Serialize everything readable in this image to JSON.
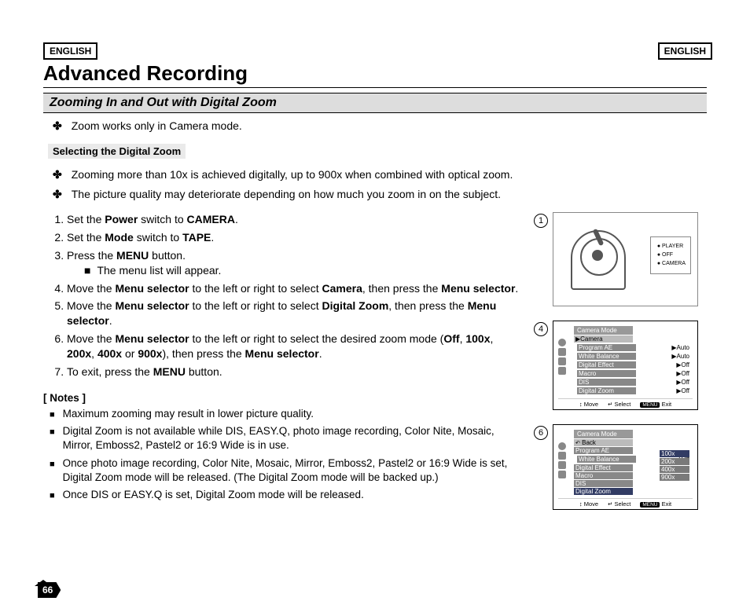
{
  "lang_label": "ENGLISH",
  "title": "Advanced Recording",
  "subtitle": "Zooming In and Out with Digital Zoom",
  "intro_bullet": "Zoom works only in Camera mode.",
  "subhead": "Selecting the Digital Zoom",
  "sub_bullets": [
    "Zooming more than 10x is achieved digitally, up to 900x when combined with optical zoom.",
    "The picture quality may deteriorate depending on how much you zoom in on the subject."
  ],
  "steps": [
    {
      "pre": "Set the ",
      "b1": "Power",
      "mid": " switch to ",
      "b2": "CAMERA",
      "post": "."
    },
    {
      "pre": "Set the ",
      "b1": "Mode",
      "mid": " switch to ",
      "b2": "TAPE",
      "post": "."
    },
    {
      "pre": "Press the ",
      "b1": "MENU",
      "mid": " button.",
      "b2": "",
      "post": ""
    },
    {
      "sub": "The menu list will appear."
    },
    {
      "pre": "Move the ",
      "b1": "Menu selector",
      "mid": " to the left or right to select ",
      "b2": "Camera",
      "post": ", then press the ",
      "b3": "Menu selector",
      "post2": "."
    },
    {
      "pre": "Move the ",
      "b1": "Menu selector",
      "mid": " to the left or right to select ",
      "b2": "Digital Zoom",
      "post": ", then press the ",
      "b3": "Menu selector",
      "post2": "."
    },
    {
      "pre": "Move the ",
      "b1": "Menu selector",
      "mid": " to the left or right to select the desired zoom mode (",
      "b2": "Off",
      "post": ", ",
      "b3": "100x",
      "post2": ", ",
      "b4": "200x",
      "post3": ", ",
      "b5": "400x",
      "post4": " or ",
      "b6": "900x",
      "post5": "), then press the ",
      "b7": "Menu selector",
      "post6": "."
    },
    {
      "pre": "To exit, press the ",
      "b1": "MENU",
      "mid": " button.",
      "b2": "",
      "post": ""
    }
  ],
  "notes_head": "[ Notes ]",
  "notes": [
    "Maximum zooming may result in lower picture quality.",
    "Digital Zoom is not available while DIS, EASY.Q, photo image recording, Color Nite, Mosaic, Mirror, Emboss2, Pastel2 or 16:9 Wide is in use.",
    "Once photo image recording, Color Nite, Mosaic, Mirror, Emboss2, Pastel2 or 16:9 Wide is set, Digital Zoom mode will be released. (The Digital Zoom mode will be backed up.)",
    "Once DIS or EASY.Q is set, Digital Zoom mode will be released."
  ],
  "fig1": {
    "num": "1",
    "modes": [
      "PLAYER",
      "OFF",
      "CAMERA"
    ]
  },
  "fig4": {
    "num": "4",
    "title": "Camera Mode",
    "header": "▶Camera",
    "items": [
      {
        "l": "Program AE",
        "r": "▶Auto"
      },
      {
        "l": "White Balance",
        "r": "▶Auto"
      },
      {
        "l": "Digital Effect",
        "r": "▶Off"
      },
      {
        "l": "Macro",
        "r": "▶Off"
      },
      {
        "l": "DIS",
        "r": "▶Off"
      },
      {
        "l": "Digital Zoom",
        "r": "▶Off"
      }
    ],
    "foot": {
      "move": "Move",
      "select": "Select",
      "exit": "Exit",
      "menu": "MENU"
    }
  },
  "fig6": {
    "num": "6",
    "title": "Camera Mode",
    "header": "Back",
    "items": [
      "Program AE",
      "White Balance",
      "Digital Effect",
      "Macro",
      "DIS",
      "Digital Zoom"
    ],
    "check": "✓Off",
    "options": [
      "100x",
      "200x",
      "400x",
      "900x"
    ],
    "foot": {
      "move": "Move",
      "select": "Select",
      "exit": "Exit",
      "menu": "MENU"
    }
  },
  "page_number": "66"
}
